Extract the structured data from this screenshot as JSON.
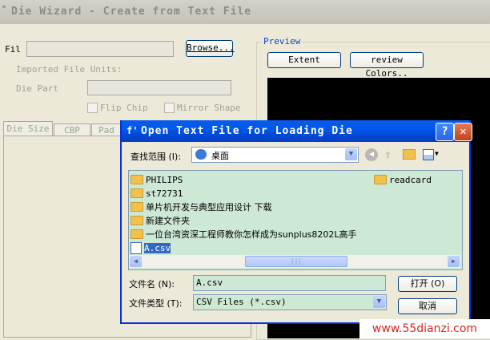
{
  "main_window": {
    "title_icon": "\"",
    "title": "Die Wizard - Create from Text File",
    "file_label": "Fil",
    "browse_label": "Browse...",
    "imported_units_label": "Imported File Units:",
    "die_part_label": "Die Part",
    "flip_chip_label": "Flip Chip",
    "mirror_shape_label": "Mirror Shape",
    "tabs": [
      "Die Size",
      "CBP",
      "Pad"
    ],
    "preview_label": "Preview",
    "extent_label": "Extent",
    "preview_colors_label": "review Colors.."
  },
  "dialog": {
    "title_icon": "f'",
    "title": "Open Text File for Loading Die",
    "help_label": "?",
    "close_label": "✕",
    "look_in_label": "查找范围 (I):",
    "look_in_value": "桌面",
    "files": [
      {
        "name": "PHILIPS",
        "type": "folder"
      },
      {
        "name": "st72731",
        "type": "folder"
      },
      {
        "name": "单片机开发与典型应用设计 下载",
        "type": "folder"
      },
      {
        "name": "新建文件夹",
        "type": "folder"
      },
      {
        "name": "一位台湾资深工程师教你怎样成为sunplus8202L高手",
        "type": "folder"
      },
      {
        "name": "A.csv",
        "type": "file",
        "selected": true
      },
      {
        "name": "readcard",
        "type": "folder"
      }
    ],
    "filename_label": "文件名 (N):",
    "filename_value": "A.csv",
    "filetype_label": "文件类型 (T):",
    "filetype_value": "CSV Files (*.csv)",
    "open_label": "打开 (O)",
    "cancel_label": "取消"
  },
  "watermark": "www.55dianzi.com"
}
